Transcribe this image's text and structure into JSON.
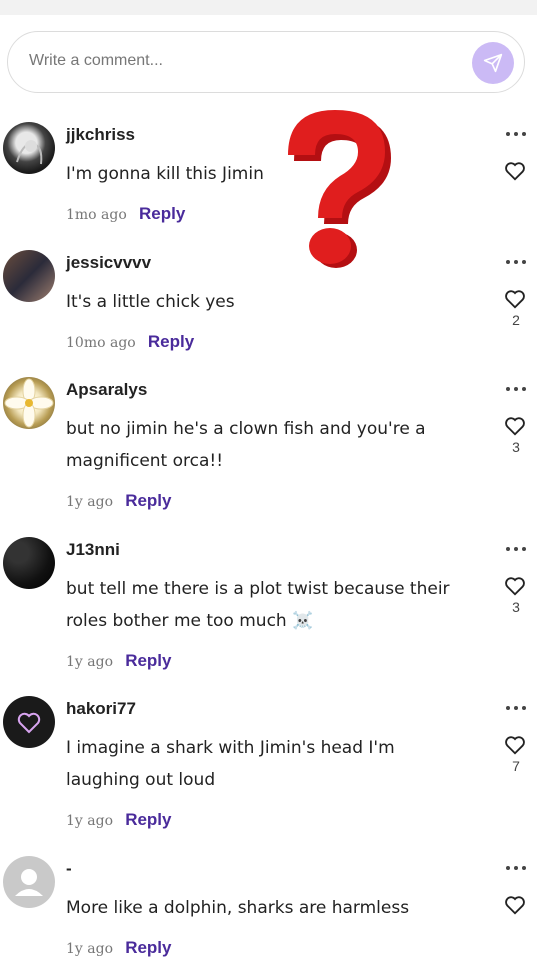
{
  "composer": {
    "placeholder": "Write a comment..."
  },
  "comments": [
    {
      "username": "jjkchriss",
      "lines": [
        "I'm gonna kill this Jimin"
      ],
      "time": "1mo ago",
      "reply": "Reply",
      "likes": ""
    },
    {
      "username": "jessicvvvv",
      "lines": [
        "It's a little chick yes"
      ],
      "time": "10mo ago",
      "reply": "Reply",
      "likes": "2"
    },
    {
      "username": "Apsaralys",
      "lines": [
        "but no jimin he's a clown fish and you're a",
        "magnificent orca!!"
      ],
      "time": "1y ago",
      "reply": "Reply",
      "likes": "3"
    },
    {
      "username": "J13nni",
      "lines": [
        "but tell me there is a plot twist because their",
        "roles bother me too much ☠️"
      ],
      "time": "1y ago",
      "reply": "Reply",
      "likes": "3"
    },
    {
      "username": "hakori77",
      "lines": [
        "I imagine a shark with Jimin's head I'm",
        "laughing out loud"
      ],
      "time": "1y ago",
      "reply": "Reply",
      "likes": "7"
    },
    {
      "username": "-",
      "lines": [
        "More like a dolphin, sharks are harmless"
      ],
      "time": "1y ago",
      "reply": "Reply",
      "likes": ""
    }
  ],
  "colors": {
    "accent": "#4a2b9b",
    "send_button": "#cbbaf5",
    "question_mark": "#e01e1e"
  },
  "icons": {
    "send": "send-icon",
    "more": "more-dots-icon",
    "like": "heart-icon",
    "overlay": "question-mark-icon"
  }
}
